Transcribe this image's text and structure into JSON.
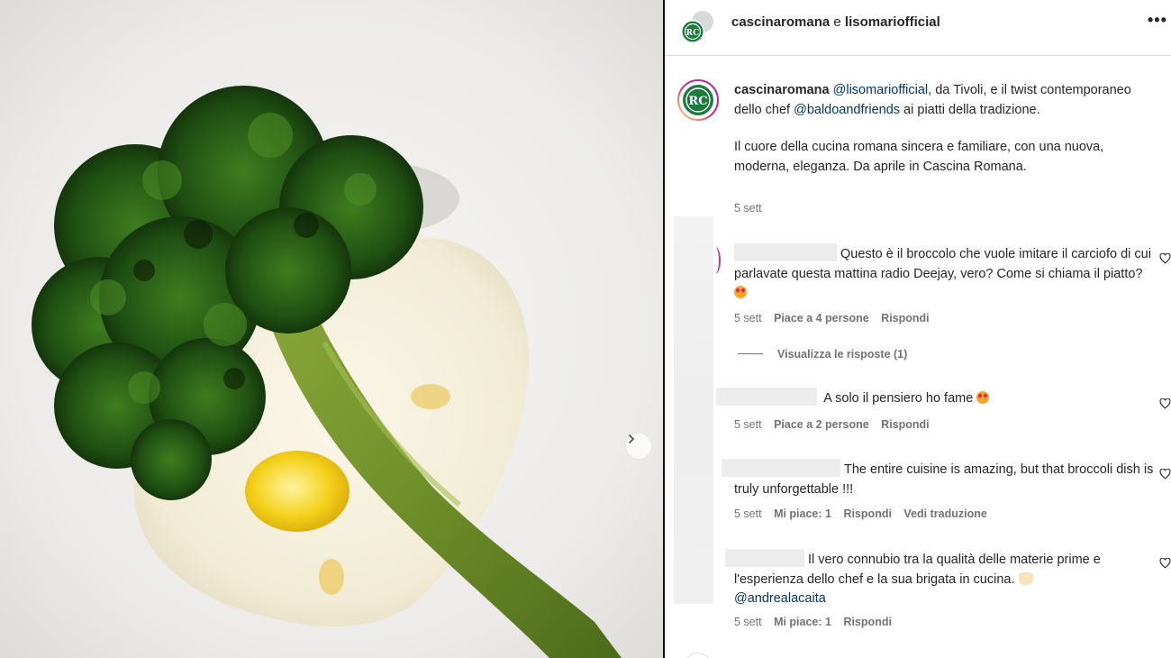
{
  "post": {
    "author": "cascinaromana",
    "connector": "e",
    "coauthor": "lisomariofficial",
    "more_label": "•••"
  },
  "caption": {
    "username": "cascinaromana",
    "mention1": "@lisomariofficial",
    "text1": ", da Tivoli, e il twist contemporaneo dello chef ",
    "mention2": "@baldoandfriends",
    "text2": " ai piatti della tradizione.",
    "paragraph2": "Il cuore della cucina romana sincera e familiare, con una nuova, moderna, eleganza. Da aprile in Cascina Romana.",
    "time": "5 sett"
  },
  "comments": [
    {
      "text": "Questo è il broccolo che vuole imitare il carciofo di cui parlavate questa mattina radio Deejay, vero? Come si chiama il piatto?",
      "time": "5 sett",
      "likes": "Piace a 4 persone",
      "reply": "Rispondi"
    },
    {
      "text": "A solo il pensiero ho fame",
      "time": "5 sett",
      "likes": "Piace a 2 persone",
      "reply": "Rispondi"
    },
    {
      "text": "The entire cuisine is amazing, but that broccoli dish is truly unforgettable !!!",
      "time": "5 sett",
      "likes": "Mi piace: 1",
      "reply": "Rispondi",
      "translate": "Vedi traduzione"
    },
    {
      "text": "Il vero connubio tra la qualità delle materie prime e l'esperienza dello chef e la sua brigata in cucina.",
      "mention": "@andrealacaita",
      "time": "5 sett",
      "likes": "Mi piace: 1",
      "reply": "Rispondi"
    }
  ],
  "view_replies": "Visualizza le risposte (1)",
  "colors": {
    "brand_green": "#1d7a3e",
    "mention_blue": "#00376b",
    "muted_text": "#737373",
    "divider": "#dbdbdb"
  },
  "icons": {
    "next": "chevron-right-icon",
    "heart": "heart-outline-icon",
    "more": "more-horizontal-icon"
  }
}
